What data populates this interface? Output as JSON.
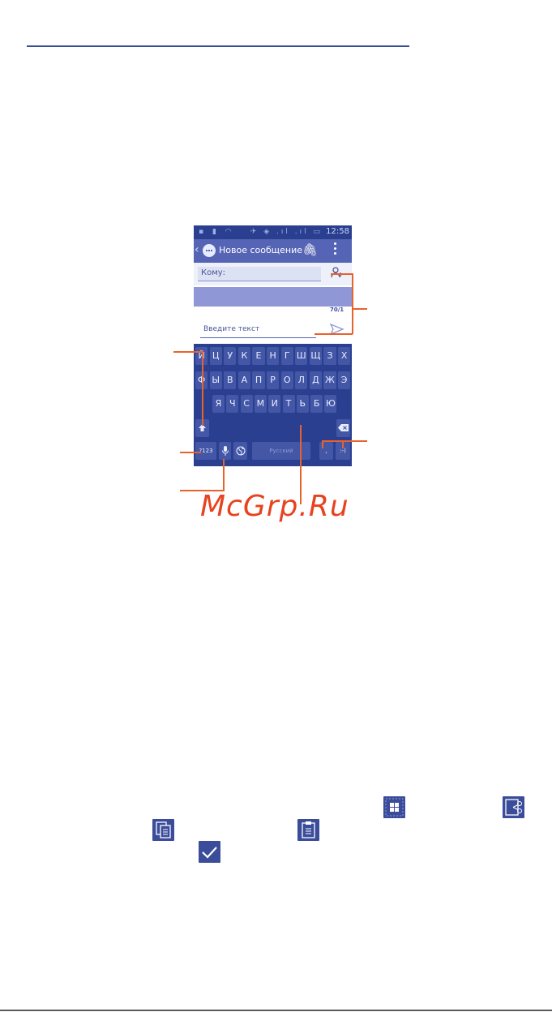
{
  "phone": {
    "status_bar": {
      "time": "12:58"
    },
    "action_bar": {
      "back": "‹",
      "title": "Новое сообщение"
    },
    "to_field": {
      "label": "Кому:"
    },
    "counter": "70/1",
    "compose": {
      "placeholder": "Введите текст"
    },
    "keyboard": {
      "row1": [
        "Й",
        "Ц",
        "У",
        "К",
        "Е",
        "Н",
        "Г",
        "Ш",
        "Щ",
        "З",
        "Х"
      ],
      "row2": [
        "Ф",
        "Ы",
        "В",
        "А",
        "П",
        "Р",
        "О",
        "Л",
        "Д",
        "Ж",
        "Э"
      ],
      "row3": [
        "Я",
        "Ч",
        "С",
        "М",
        "И",
        "Т",
        "Ь",
        "Б",
        "Ю"
      ],
      "symbols_key": "?123",
      "space_key": "Русский",
      "period_key": ".",
      "emoji_key": ":-)"
    }
  },
  "watermark": "McGrp.Ru",
  "icons": {
    "accent": "#e8622c",
    "brand": "#3b4c9a",
    "items": [
      "select-all-icon",
      "cut-icon",
      "copy-icon",
      "paste-icon",
      "done-icon"
    ]
  }
}
